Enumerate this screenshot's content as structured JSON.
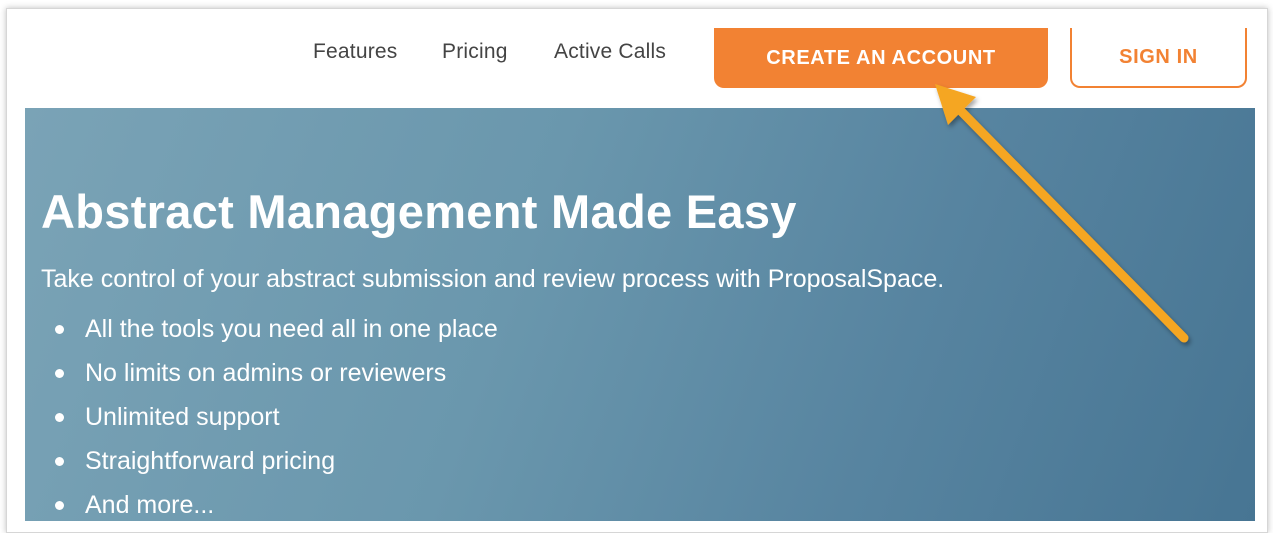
{
  "nav": {
    "links": [
      {
        "label": "Features"
      },
      {
        "label": "Pricing"
      },
      {
        "label": "Active Calls"
      }
    ],
    "create_account_label": "CREATE AN ACCOUNT",
    "sign_in_label": "SIGN IN"
  },
  "hero": {
    "title": "Abstract Management Made Easy",
    "subtitle": "Take control of your abstract submission and review process with ProposalSpace.",
    "bullets": [
      "All the tools you need all in one place",
      "No limits on admins or reviewers",
      "Unlimited support",
      "Straightforward pricing",
      "And more..."
    ]
  },
  "colors": {
    "accent": "#f28233",
    "hero_start": "#7aa3b6",
    "hero_end": "#477593",
    "annotation_arrow": "#f5a623"
  },
  "icons": {
    "annotation": "arrow-pointer-icon"
  }
}
